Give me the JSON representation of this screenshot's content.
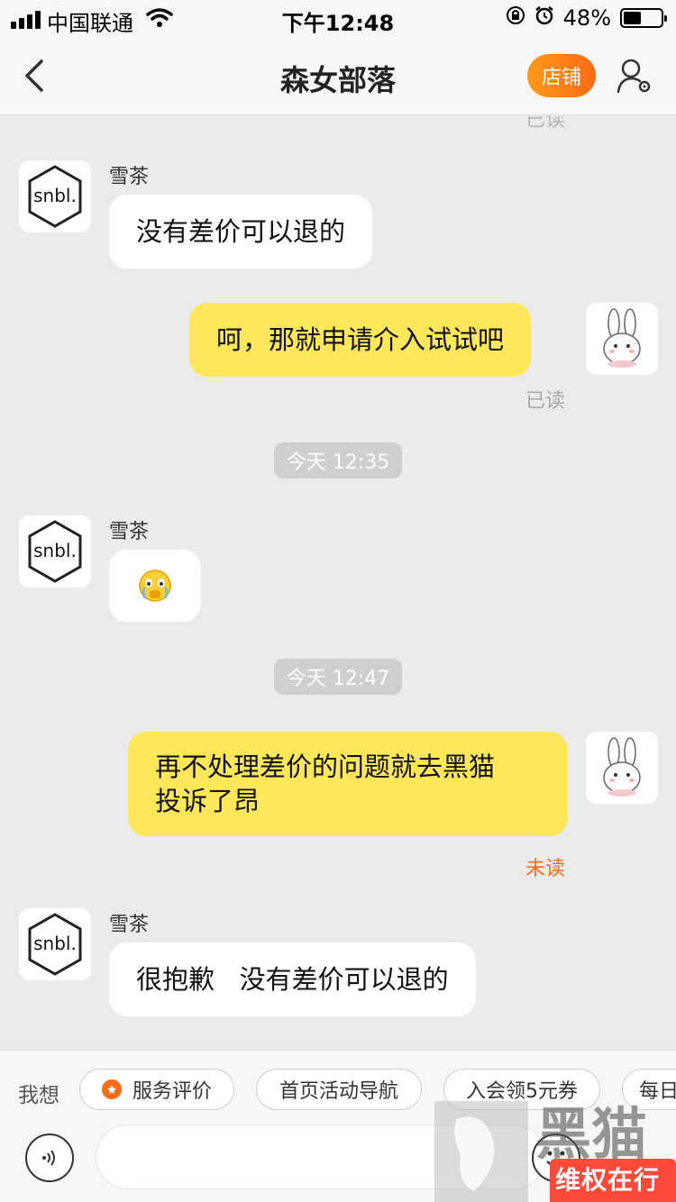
{
  "status_bar": {
    "carrier": "中国联通",
    "time": "下午12:48",
    "battery": "48%",
    "battery_level": 0.48
  },
  "nav": {
    "title": "森女部落",
    "shop_label": "店铺"
  },
  "avatar_text": "snbl.",
  "messages": {
    "top_read": "已读",
    "m1": {
      "sender": "雪茶",
      "text": "没有差价可以退的"
    },
    "m2": {
      "text": "呵，那就申请介入试试吧",
      "status": "已读"
    },
    "t1": "今天 12:35",
    "m3": {
      "sender": "雪茶",
      "emoji_name": "crying-face"
    },
    "t2": "今天 12:47",
    "m4": {
      "text_line1": "再不处理差价的问题就去黑猫",
      "text_line2": "投诉了昂",
      "status": "未读"
    },
    "m5": {
      "sender": "雪茶",
      "text": "很抱歉   没有差价可以退的"
    }
  },
  "quick_bar": {
    "label": "我想",
    "chips": [
      "服务评价",
      "首页活动导航",
      "入会领5元券",
      "每日"
    ]
  },
  "watermark": {
    "text": "维权在行动",
    "brand": "黑猫"
  },
  "colors": {
    "accent": "#ff6a12",
    "bubble_out": "#ffe75a",
    "bubble_in": "#ffffff",
    "background": "#ebebeb",
    "unread": "#ff6a1a"
  }
}
